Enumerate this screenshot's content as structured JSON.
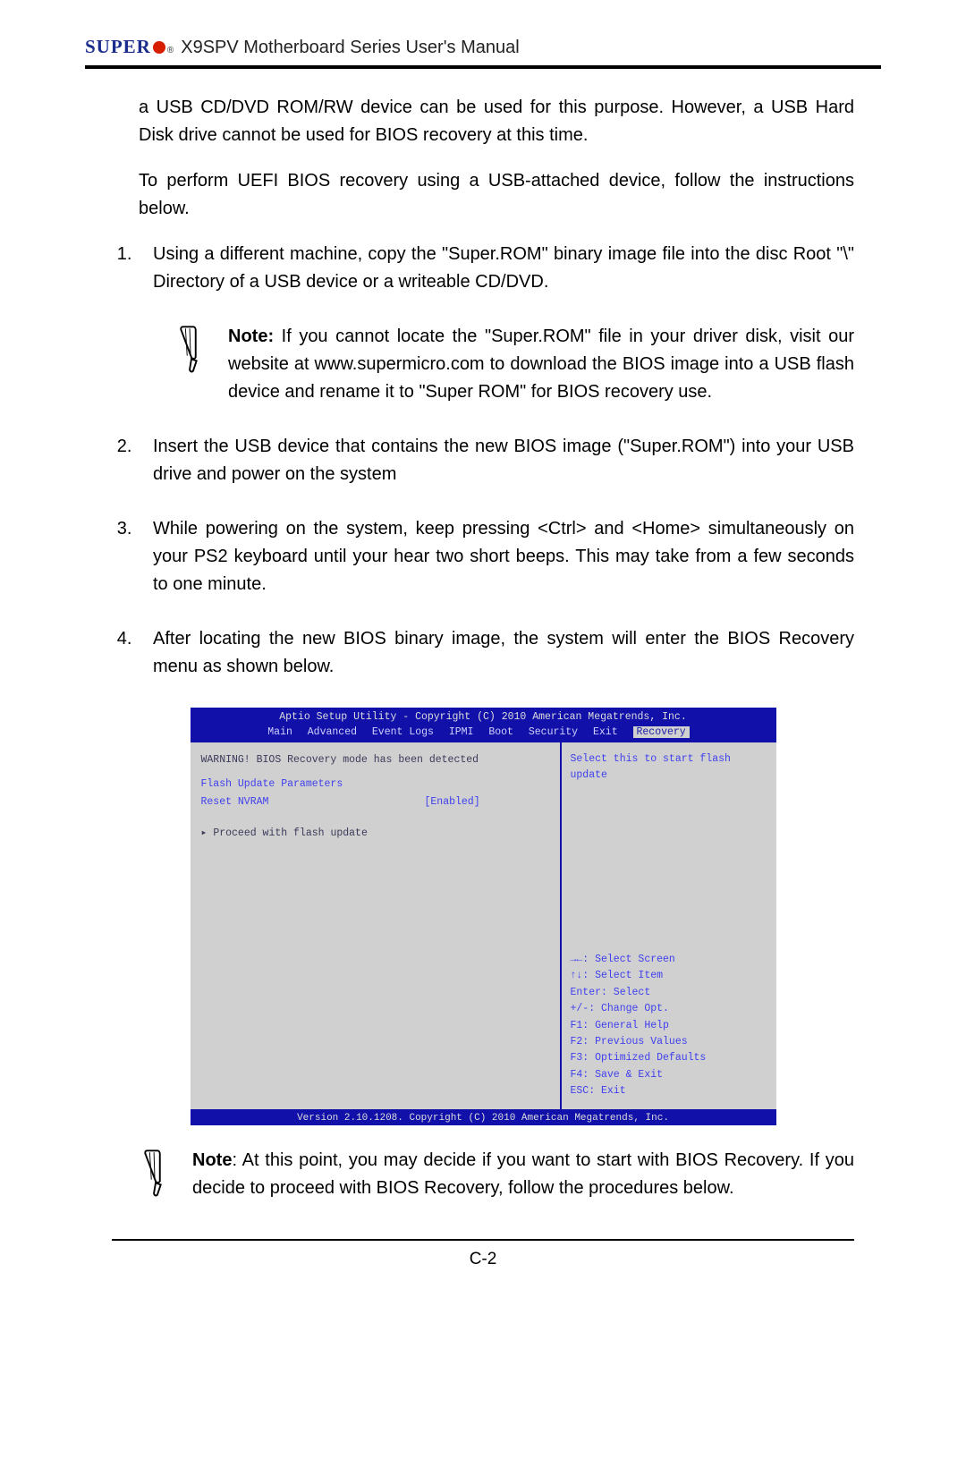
{
  "header": {
    "brand": "SUPER",
    "title": "X9SPV Motherboard Series User's Manual"
  },
  "para1": "a USB CD/DVD ROM/RW device can be used for this purpose. However, a USB Hard Disk drive cannot be used for BIOS recovery at this time.",
  "para2": "To perform UEFI BIOS recovery using a USB-attached device, follow the instructions below.",
  "steps": {
    "s1": "Using a different machine, copy the \"Super.ROM\" binary image file into the disc Root \"\\\" Directory of a USB device or a writeable CD/DVD.",
    "s2": "Insert the USB device that contains the new BIOS image (\"Super.ROM\") into your USB drive and power on the system",
    "s3": "While powering on the system, keep pressing <Ctrl> and <Home> simultaneously on your PS2 keyboard until your hear two short beeps. This may take from a few seconds to one minute.",
    "s4": "After locating the new BIOS binary image, the system will enter the BIOS Recovery menu as shown below."
  },
  "note1": {
    "label": "Note:",
    "text": " If you cannot locate the \"Super.ROM\" file in your driver disk, visit our website at www.supermicro.com to download the BIOS image into a USB flash device and rename it to \"Super ROM\" for BIOS recovery use."
  },
  "note2": {
    "label": "Note",
    "text": ": At this point, you may decide if you want to start with BIOS Recovery. If you decide to proceed with BIOS Recovery, follow the procedures below."
  },
  "bios": {
    "title_top": "Aptio Setup Utility - Copyright (C) 2010 American Megatrends, Inc.",
    "menu": [
      "Main",
      "Advanced",
      "Event Logs",
      "IPMI",
      "Boot",
      "Security",
      "Exit",
      "Recovery"
    ],
    "active_menu": "Recovery",
    "warning": "WARNING! BIOS Recovery mode has been detected",
    "section": "Flash Update Parameters",
    "opt_label": "Reset NVRAM",
    "opt_value": "[Enabled]",
    "proceed": "Proceed with flash update",
    "right_help": "Select this to start flash update",
    "keys": [
      "→←: Select Screen",
      "↑↓: Select Item",
      "Enter: Select",
      "+/-: Change Opt.",
      "F1: General Help",
      "F2: Previous Values",
      "F3: Optimized Defaults",
      "F4: Save & Exit",
      "ESC: Exit"
    ],
    "footer": "Version 2.10.1208. Copyright (C) 2010 American Megatrends, Inc."
  },
  "page_number": "C-2"
}
